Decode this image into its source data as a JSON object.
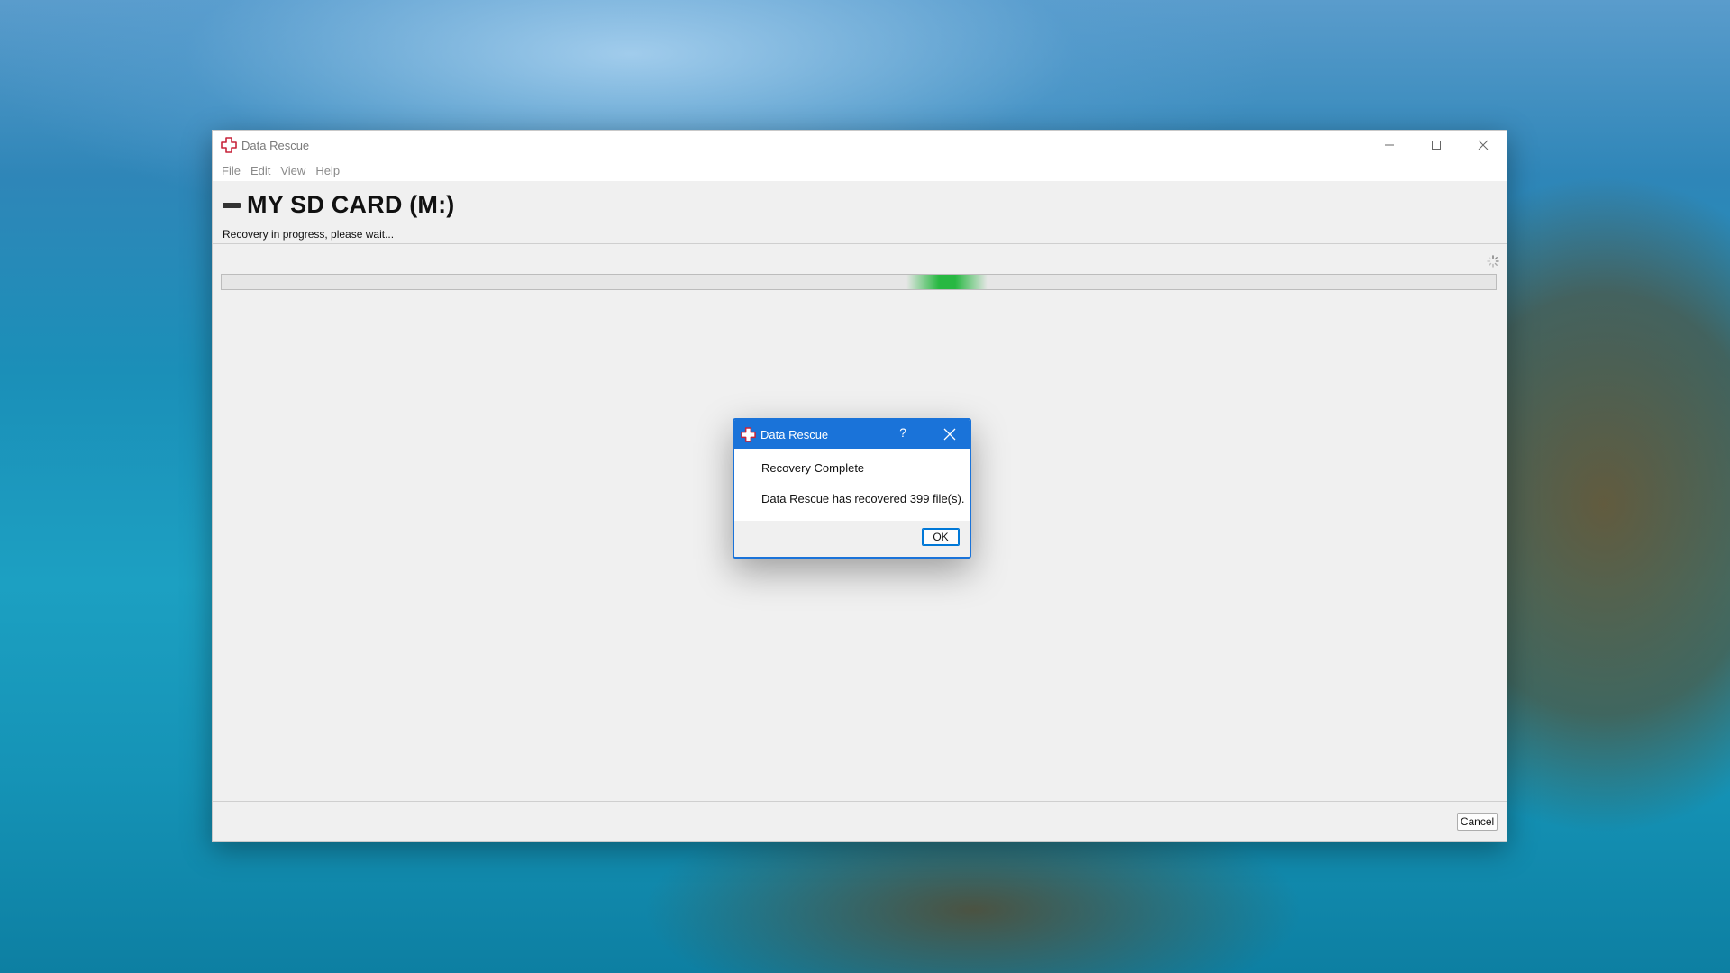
{
  "window": {
    "title": "Data Rescue",
    "menu": [
      "File",
      "Edit",
      "View",
      "Help"
    ]
  },
  "header": {
    "drive_title": "MY SD CARD (M:)",
    "status": "Recovery in progress, please wait..."
  },
  "progress": {
    "mode": "indeterminate",
    "color": "#06b025"
  },
  "footer": {
    "cancel_label": "Cancel"
  },
  "dialog": {
    "title": "Data Rescue",
    "help_label": "?",
    "heading": "Recovery Complete",
    "message": "Data Rescue has recovered 399 file(s).",
    "ok_label": "OK",
    "accent_color": "#1a73d9"
  },
  "icons": {
    "app": "data-rescue-cross-icon",
    "drive": "drive-icon",
    "spinner": "spinner-icon"
  }
}
